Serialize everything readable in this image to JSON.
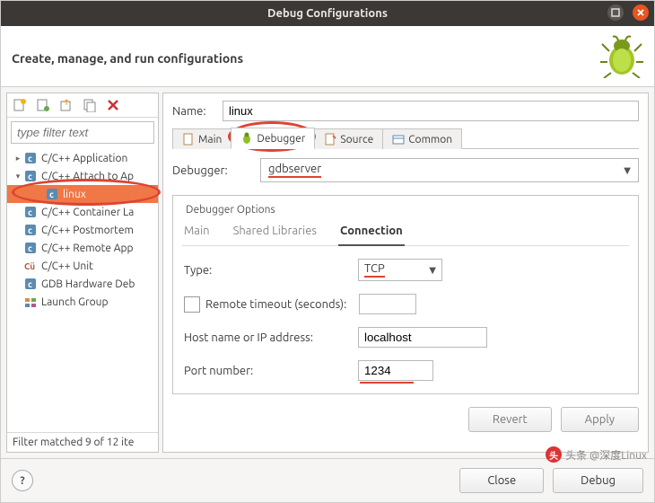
{
  "window": {
    "title": "Debug Configurations",
    "subtitle": "Create, manage, and run configurations"
  },
  "left": {
    "filter_placeholder": "type filter text",
    "items": [
      {
        "label": "C/C++ Application",
        "toggle": "▸",
        "icon": "c"
      },
      {
        "label": "C/C++ Attach to Ap",
        "toggle": "▾",
        "icon": "c"
      },
      {
        "label": "linux",
        "toggle": "",
        "icon": "c",
        "selected": true,
        "level": 2
      },
      {
        "label": "C/C++ Container La",
        "toggle": "",
        "icon": "c"
      },
      {
        "label": "C/C++ Postmortem",
        "toggle": "",
        "icon": "c"
      },
      {
        "label": "C/C++ Remote App",
        "toggle": "",
        "icon": "c"
      },
      {
        "label": "C/C++ Unit",
        "toggle": "",
        "icon": "cu"
      },
      {
        "label": "GDB Hardware Deb",
        "toggle": "",
        "icon": "c"
      },
      {
        "label": "Launch Group",
        "toggle": "",
        "icon": "lg"
      }
    ],
    "status": "Filter matched 9 of 12 ite"
  },
  "right": {
    "name_label": "Name:",
    "name_value": "linux",
    "tabs": {
      "main": "Main",
      "debugger": "Debugger",
      "source": "Source",
      "common": "Common"
    },
    "debugger_label": "Debugger:",
    "debugger_value": "gdbserver",
    "group_title": "Debugger Options",
    "subtabs": {
      "main": "Main",
      "shared": "Shared Libraries",
      "connection": "Connection"
    },
    "connection": {
      "type_label": "Type:",
      "type_value": "TCP",
      "timeout_label": "Remote timeout (seconds):",
      "timeout_value": "",
      "host_label": "Host name or IP address:",
      "host_value": "localhost",
      "port_label": "Port number:",
      "port_value": "1234"
    },
    "buttons": {
      "revert": "Revert",
      "apply": "Apply"
    }
  },
  "bottom": {
    "debug": "Debug",
    "close": "Close"
  },
  "watermark": "头条 @深度Linux"
}
